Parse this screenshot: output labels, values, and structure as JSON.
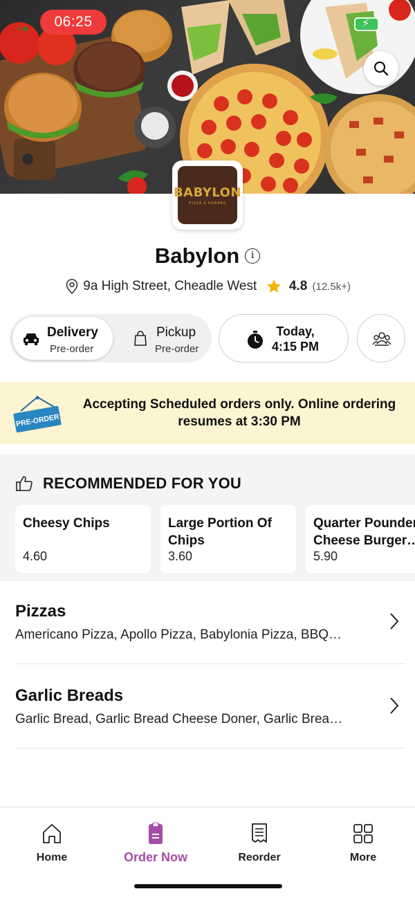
{
  "status_bar": {
    "time": "06:25"
  },
  "store": {
    "name": "Babylon",
    "logo_text": "BABYLON",
    "logo_subtext": "PIZZA & KEBABS",
    "address": "9a High Street, Cheadle West",
    "rating": "4.8",
    "rating_count": "(12.5k+)"
  },
  "order_mode": {
    "delivery_label": "Delivery",
    "delivery_sub": "Pre-order",
    "pickup_label": "Pickup",
    "pickup_sub": "Pre-order",
    "selected": "Delivery"
  },
  "schedule": {
    "line1": "Today,",
    "line2": "4:15 PM"
  },
  "banner": {
    "tag": "PRE-ORDER",
    "message": "Accepting Scheduled orders only. Online ordering resumes at 3:30 PM"
  },
  "recommended": {
    "title": "RECOMMENDED FOR YOU",
    "items": [
      {
        "name": "Cheesy Chips",
        "price": "4.60"
      },
      {
        "name": "Large Portion Of Chips",
        "price": "3.60"
      },
      {
        "name": "Quarter Pounder Cheese Burger…",
        "price": "5.90"
      }
    ]
  },
  "categories": [
    {
      "title": "Pizzas",
      "desc": "Americano Pizza, Apollo Pizza, Babylonia Pizza, BBQ…"
    },
    {
      "title": "Garlic Breads",
      "desc": "Garlic Bread, Garlic Bread Cheese Doner, Garlic Brea…"
    }
  ],
  "bottom_nav": {
    "home": "Home",
    "order_now": "Order Now",
    "reorder": "Reorder",
    "more": "More"
  },
  "colors": {
    "accent": "#a64ca6",
    "banner_bg": "#fdf4d2",
    "status_pill": "#ef3b3b",
    "star": "#f5b400"
  }
}
